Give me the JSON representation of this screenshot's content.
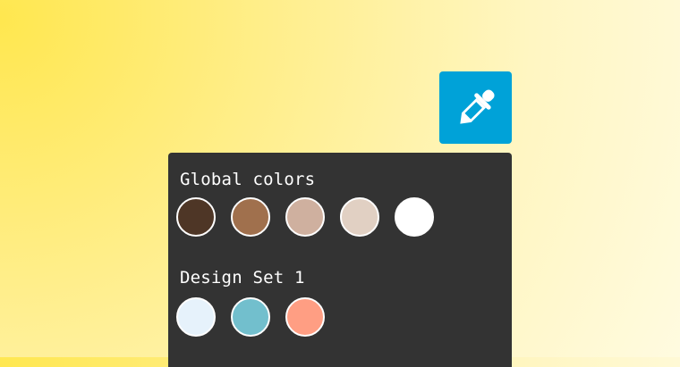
{
  "eyedropper": {
    "icon": "eyedropper-icon",
    "color": "#00a2d8"
  },
  "panel": {
    "groups": [
      {
        "label": "Global colors",
        "swatches": [
          "#4e3626",
          "#a0704d",
          "#cfb09f",
          "#e1d0c3",
          "#ffffff"
        ]
      },
      {
        "label": "Design Set 1",
        "swatches": [
          "#e6f2fb",
          "#72bfcd",
          "#ff9e83"
        ]
      }
    ]
  }
}
